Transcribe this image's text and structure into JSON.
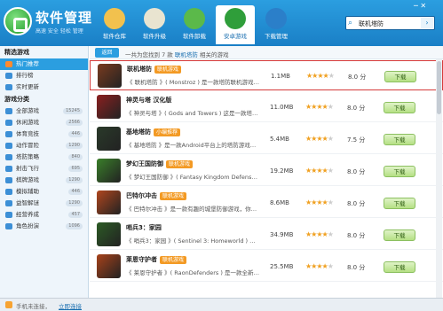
{
  "app": {
    "title": "软件管理",
    "subtitle": "高速 安全 轻松 管理",
    "win_controls": "─ ✕"
  },
  "nav": [
    {
      "label": "软件仓库",
      "color": "#f2c14e"
    },
    {
      "label": "软件升级",
      "color": "#e9e4d0"
    },
    {
      "label": "软件卸载",
      "color": "#5bb94a"
    },
    {
      "label": "安卓游戏",
      "color": "#2f9e3a"
    },
    {
      "label": "下载管理",
      "color": "#2b7fc9"
    }
  ],
  "search": {
    "value": "联机塔防",
    "go": "›"
  },
  "sidebar": {
    "section1": "精选游戏",
    "featured": [
      {
        "label": "热门推荐",
        "color": "#ff8a2e"
      },
      {
        "label": "排行榜",
        "color": "#3c8fd6"
      },
      {
        "label": "实时更新",
        "color": "#3c8fd6"
      }
    ],
    "section2": "游戏分类",
    "categories": [
      {
        "label": "全部游戏",
        "count": "15245",
        "color": "#3c8fd6"
      },
      {
        "label": "休闲游戏",
        "count": "2566",
        "color": "#3c8fd6"
      },
      {
        "label": "体育竞技",
        "count": "446",
        "color": "#3c8fd6"
      },
      {
        "label": "动作冒险",
        "count": "1290",
        "color": "#3c8fd6"
      },
      {
        "label": "塔防策略",
        "count": "840",
        "color": "#3c8fd6"
      },
      {
        "label": "射击飞行",
        "count": "695",
        "color": "#3c8fd6"
      },
      {
        "label": "棋牌游戏",
        "count": "1290",
        "color": "#3c8fd6"
      },
      {
        "label": "模拟辅助",
        "count": "446",
        "color": "#3c8fd6"
      },
      {
        "label": "益智解谜",
        "count": "1290",
        "color": "#3c8fd6"
      },
      {
        "label": "经营养成",
        "count": "457",
        "color": "#3c8fd6"
      },
      {
        "label": "角色扮演",
        "count": "1096",
        "color": "#3c8fd6"
      }
    ]
  },
  "content": {
    "back_label": "返回",
    "result_prefix": "一共为您找到 7 款",
    "result_keyword": "联机塔防",
    "result_suffix": "相关的游戏"
  },
  "games": [
    {
      "name": "联机塔防",
      "badge": "联机游戏",
      "desc": "《 联机塔防 》( Monstroz ) 是一款塔防联机游戏 ...",
      "size": "1.1MB",
      "rating": 4,
      "score": "8.0 分",
      "download": "下载",
      "color": "#7a3b1f"
    },
    {
      "name": "神灵与塔 汉化版",
      "badge": "",
      "desc": "《 神灵与塔 》( Gods and Towers ) 这是一款塔防游戏 ...",
      "size": "11.0MB",
      "rating": 4,
      "score": "8.0 分",
      "download": "下载",
      "color": "#8b2020"
    },
    {
      "name": "基地塔防",
      "badge": "小编推荐",
      "desc": "《 基地塔防 》是一款Android平台上的塔防游戏的小游 ...",
      "size": "5.4MB",
      "rating": 4,
      "score": "7.5 分",
      "download": "下载",
      "color": "#2a3a2a"
    },
    {
      "name": "梦幻王国防御",
      "badge": "联机游戏",
      "desc": "《 梦幻王国防御 》( Fantasy Kingdom Defense ) ...",
      "size": "19.2MB",
      "rating": 4,
      "score": "8.0 分",
      "download": "下载",
      "color": "#3a7f2a"
    },
    {
      "name": "巴特尔冲击",
      "badge": "联机游戏",
      "desc": "《 巴特尔冲击 》是一款有趣的城堡防御游戏，你需要 ...",
      "size": "8.6MB",
      "rating": 4,
      "score": "8.0 分",
      "download": "下载",
      "color": "#b0461e"
    },
    {
      "name": "哨兵3：家园",
      "badge": "",
      "desc": "《 哨兵3：家园 》( Sentinel 3: Homeworld ) 是一款 ...",
      "size": "34.9MB",
      "rating": 4,
      "score": "8.0 分",
      "download": "下载",
      "color": "#2c5b25"
    },
    {
      "name": "莱恩守护者",
      "badge": "联机游戏",
      "desc": "《 莱恩守护者 》( RaonDefenders ) 是一款全新塔防 ...",
      "size": "25.5MB",
      "rating": 4,
      "score": "8.0 分",
      "download": "下载",
      "color": "#a8421a"
    }
  ],
  "status": {
    "text": "手机未连接，",
    "link": "立即连接"
  }
}
